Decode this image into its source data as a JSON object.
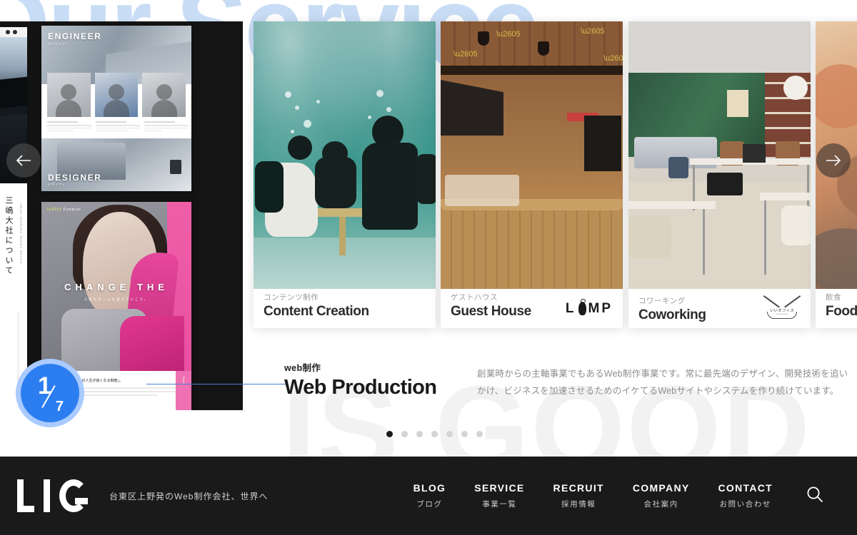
{
  "background": {
    "watermark_left": "Our Service",
    "watermark_bottom": "IS GOOD"
  },
  "slider": {
    "counter": {
      "current": "1",
      "total": "7"
    },
    "prev_label": "←",
    "next_label": "→",
    "dots_total": 7,
    "dot_active_index": 0,
    "cards": [
      {
        "name": "web-production-mockups",
        "mock": {
          "shrine_title": "三嶋大社について",
          "shrine_sub": "About Mishima Taisha Shrine",
          "engineer_label": "ENGINEER",
          "engineer_sub": "エンジニア",
          "designer_label": "DESIGNER",
          "designer_sub": "デザイナー",
          "change_title": "CHANGE THE",
          "change_sub": "人生もチームも変えていこう。",
          "change_logo": "Funplus",
          "change_body_title": "一緒に作る、「社員の人生が良くなる制度」。"
        }
      },
      {
        "name": "content-creation",
        "jp": "コンテンツ制作",
        "en": "Content Creation",
        "logo": null
      },
      {
        "name": "guest-house",
        "jp": "ゲストハウス",
        "en": "Guest House",
        "logo": "LAMP"
      },
      {
        "name": "coworking",
        "jp": "コワーキング",
        "en": "Coworking",
        "logo_main": "いいオフィス",
        "logo_sub": "coworking"
      },
      {
        "name": "food",
        "jp": "飲食",
        "en": "Food"
      }
    ]
  },
  "caption": {
    "jp": "web制作",
    "en": "Web Production",
    "description": "創業時からの主軸事業でもあるWeb制作事業です。常に最先端のデザイン、開発技術を追いかけ、ビジネスを加速させるためのイケてるWebサイトやシステムを作り続けています。"
  },
  "footer": {
    "logo": "LiG",
    "tagline": "台東区上野発のWeb制作会社、世界へ",
    "nav": [
      {
        "en": "BLOG",
        "jp": "ブログ"
      },
      {
        "en": "SERVICE",
        "jp": "事業一覧"
      },
      {
        "en": "RECRUIT",
        "jp": "採用情報"
      },
      {
        "en": "COMPANY",
        "jp": "会社案内"
      },
      {
        "en": "CONTACT",
        "jp": "お問い合わせ"
      }
    ],
    "search_icon": "search-icon"
  },
  "colors": {
    "accent_blue": "#2c7ef0",
    "ring_blue": "#aacbff",
    "watermark_blue": "#c8dcf5",
    "watermark_gray": "#f2f2f2",
    "footer_bg": "#1a1a1a",
    "line_blue": "#4d80c9"
  }
}
